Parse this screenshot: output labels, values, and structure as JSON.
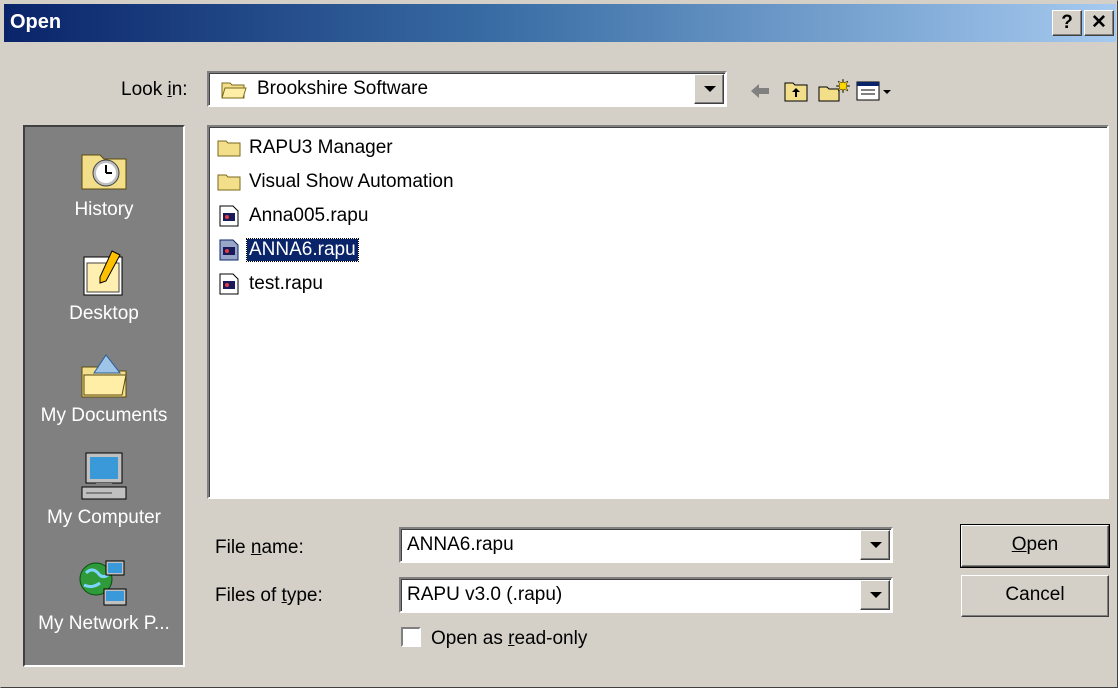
{
  "window": {
    "title": "Open",
    "help_button": "?",
    "close_button": "✕"
  },
  "look_in": {
    "label_pre": "Look ",
    "label_key": "i",
    "label_post": "n:",
    "value": "Brookshire Software"
  },
  "places": [
    {
      "label": "History",
      "icon": "history-icon"
    },
    {
      "label": "Desktop",
      "icon": "desktop-icon"
    },
    {
      "label": "My Documents",
      "icon": "my-documents-icon"
    },
    {
      "label": "My Computer",
      "icon": "my-computer-icon"
    },
    {
      "label": "My Network P...",
      "icon": "network-icon"
    }
  ],
  "files": [
    {
      "name": "RAPU3 Manager",
      "type": "folder"
    },
    {
      "name": "Visual Show Automation",
      "type": "folder"
    },
    {
      "name": "Anna005.rapu",
      "type": "file"
    },
    {
      "name": "ANNA6.rapu",
      "type": "file",
      "selected": true
    },
    {
      "name": "test.rapu",
      "type": "file"
    }
  ],
  "file_name": {
    "label_pre": "File ",
    "label_key": "n",
    "label_post": "ame:",
    "value": "ANNA6.rapu"
  },
  "file_type": {
    "label_pre": "Files of ",
    "label_key": "t",
    "label_post": "ype:",
    "value": "RAPU v3.0 (.rapu)"
  },
  "read_only": {
    "label_pre": "Open as ",
    "label_key": "r",
    "label_post": "ead-only",
    "checked": false
  },
  "buttons": {
    "open_key": "O",
    "open_rest": "pen",
    "cancel": "Cancel"
  },
  "toolbar": [
    "back-icon",
    "up-folder-icon",
    "new-folder-icon",
    "view-menu-icon"
  ]
}
